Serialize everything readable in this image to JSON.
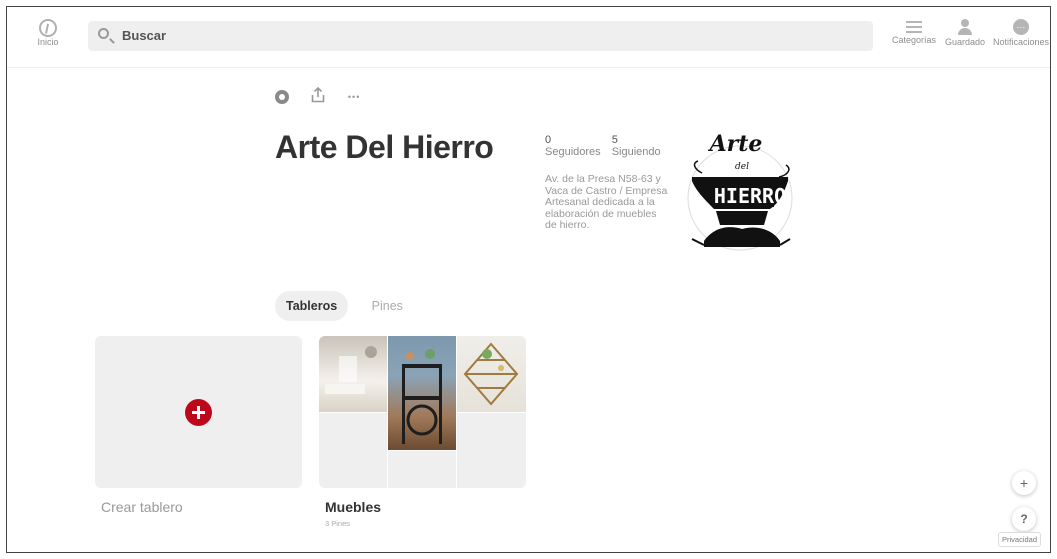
{
  "header": {
    "logo_label": "Inicio",
    "search_placeholder": "Buscar",
    "nav": [
      {
        "label": "Categorías",
        "icon": "menu-icon"
      },
      {
        "label": "Guardado",
        "icon": "user-icon"
      },
      {
        "label": "Notificaciones",
        "icon": "chat-icon"
      }
    ]
  },
  "profile": {
    "name": "Arte Del Hierro",
    "followers_count": "0",
    "followers_label": "Seguidores",
    "following_count": "5",
    "following_label": "Siguiendo",
    "bio": "Av. de la Presa N58-63 y Vaca de Castro / Empresa Artesanal dedicada a la elaboración de muebles de hierro.",
    "avatar_logo_text": [
      "Arte",
      "del",
      "HIERRO"
    ],
    "more_label": "•••"
  },
  "tabs": [
    {
      "label": "Tableros",
      "active": true
    },
    {
      "label": "Pines",
      "active": false
    }
  ],
  "boards": {
    "create_label": "Crear tablero",
    "items": [
      {
        "title": "Muebles",
        "pins": "3 Pines"
      }
    ]
  },
  "floating": {
    "add_label": "+",
    "help_label": "?",
    "privacy_label": "Privacidad"
  },
  "colors": {
    "accent": "#bd081c",
    "tile_bg": "#efefef"
  }
}
